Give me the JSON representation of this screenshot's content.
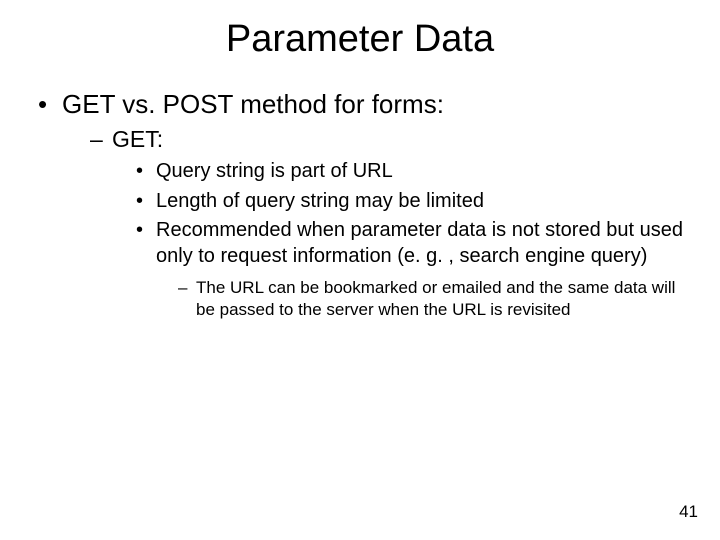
{
  "title": "Parameter Data",
  "b1": "GET vs. POST method for forms:",
  "b2": "GET:",
  "b3a": "Query string is part of URL",
  "b3b": "Length of query string may be limited",
  "b3c": "Recommended when parameter data is not stored but used only to request information (e. g. , search engine query)",
  "b4": "The URL can be bookmarked or emailed and the same data will be passed to the server when the URL is revisited",
  "page": "41"
}
